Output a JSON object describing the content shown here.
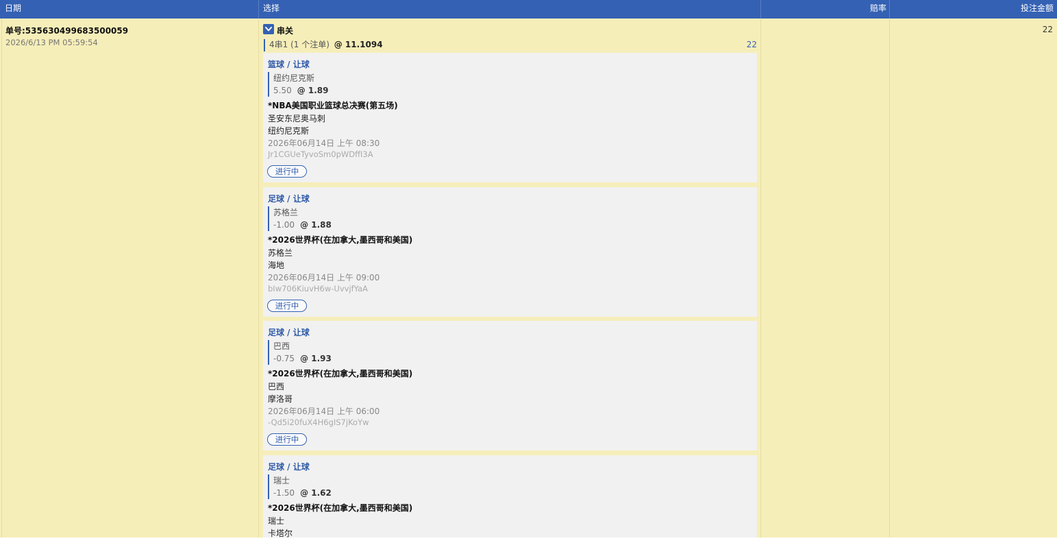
{
  "header": {
    "date": "日期",
    "selection": "选择",
    "odds": "赔率",
    "stake": "投注金额"
  },
  "order": {
    "number": "单号:535630499683500059",
    "time": "2026/6/13 PM 05:59:54",
    "stake": "22"
  },
  "parlay": {
    "title": "串关",
    "summary": "4串1 (1 个注单)",
    "total_odds": "@ 11.1094",
    "amount": "22",
    "icon": "chevron-down-icon",
    "accent": "#3461b3"
  },
  "legs": [
    {
      "category": "篮球 / 让球",
      "selection": "纽约尼克斯",
      "handicap": "5.50",
      "odds": "@ 1.89",
      "event": "*NBA美国职业篮球总决赛(第五场)",
      "home": "圣安东尼奥马刺",
      "away": "纽约尼克斯",
      "kickoff": "2026年06月14日 上午 08:30",
      "code": "Jr1CGUeTyvoSm0pWDffI3A",
      "status": "进行中"
    },
    {
      "category": "足球 / 让球",
      "selection": "苏格兰",
      "handicap": "-1.00",
      "odds": "@ 1.88",
      "event": "*2026世界杯(在加拿大,墨西哥和美国)",
      "home": "苏格兰",
      "away": "海地",
      "kickoff": "2026年06月14日 上午 09:00",
      "code": "bIw706KiuvH6w-UvvjfYaA",
      "status": "进行中"
    },
    {
      "category": "足球 / 让球",
      "selection": "巴西",
      "handicap": "-0.75",
      "odds": "@ 1.93",
      "event": "*2026世界杯(在加拿大,墨西哥和美国)",
      "home": "巴西",
      "away": "摩洛哥",
      "kickoff": "2026年06月14日 上午 06:00",
      "code": "-Qd5i20fuX4H6gIS7jKoYw",
      "status": "进行中"
    },
    {
      "category": "足球 / 让球",
      "selection": "瑞士",
      "handicap": "-1.50",
      "odds": "@ 1.62",
      "event": "*2026世界杯(在加拿大,墨西哥和美国)",
      "home": "瑞士",
      "away": "卡塔尔"
    }
  ]
}
